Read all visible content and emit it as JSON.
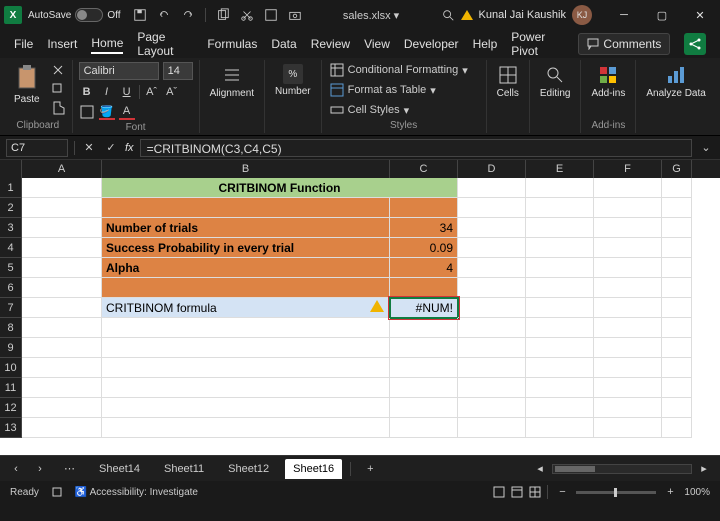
{
  "titlebar": {
    "autosave_label": "AutoSave",
    "autosave_state": "Off",
    "filename": "sales.xlsx ▾",
    "username": "Kunal Jai Kaushik",
    "initials": "KJ"
  },
  "menubar": {
    "items": [
      "File",
      "Insert",
      "Home",
      "Page Layout",
      "Formulas",
      "Data",
      "Review",
      "View",
      "Developer",
      "Help",
      "Power Pivot"
    ],
    "active": "Home",
    "comments": "Comments"
  },
  "ribbon": {
    "clipboard": {
      "paste": "Paste",
      "label": "Clipboard"
    },
    "font": {
      "name": "Calibri",
      "size": "14",
      "label": "Font",
      "bold": "B",
      "italic": "I",
      "underline": "U",
      "grow": "Aˆ",
      "shrink": "Aˇ"
    },
    "alignment": {
      "btn": "Alignment"
    },
    "number": {
      "btn": "Number",
      "fmt": "%"
    },
    "styles": {
      "cond": "Conditional Formatting",
      "table": "Format as Table",
      "cell": "Cell Styles",
      "label": "Styles"
    },
    "cells": {
      "btn": "Cells"
    },
    "editing": {
      "btn": "Editing"
    },
    "addins": {
      "btn": "Add-ins",
      "label": "Add-ins"
    },
    "analyze": {
      "btn": "Analyze Data"
    }
  },
  "formula_bar": {
    "cell_ref": "C7",
    "formula": "=CRITBINOM(C3,C4,C5)"
  },
  "sheet": {
    "columns": [
      "A",
      "B",
      "C",
      "D",
      "E",
      "F",
      "G"
    ],
    "rows": [
      "1",
      "2",
      "3",
      "4",
      "5",
      "6",
      "7",
      "8",
      "9",
      "10",
      "11",
      "12",
      "13"
    ],
    "header_text": "CRITBINOM Function",
    "b3": "Number of trials",
    "b4": "Success Probability in every trial",
    "b5": "Alpha",
    "b7": "CRITBINOM formula",
    "c3": "34",
    "c4": "0.09",
    "c5": "4",
    "c7": "#NUM!"
  },
  "tabs": {
    "sheets": [
      "Sheet14",
      "Sheet11",
      "Sheet12",
      "Sheet16"
    ],
    "active": "Sheet16",
    "add": "+"
  },
  "status": {
    "ready": "Ready",
    "access": "Accessibility: Investigate",
    "zoom": "100%"
  }
}
